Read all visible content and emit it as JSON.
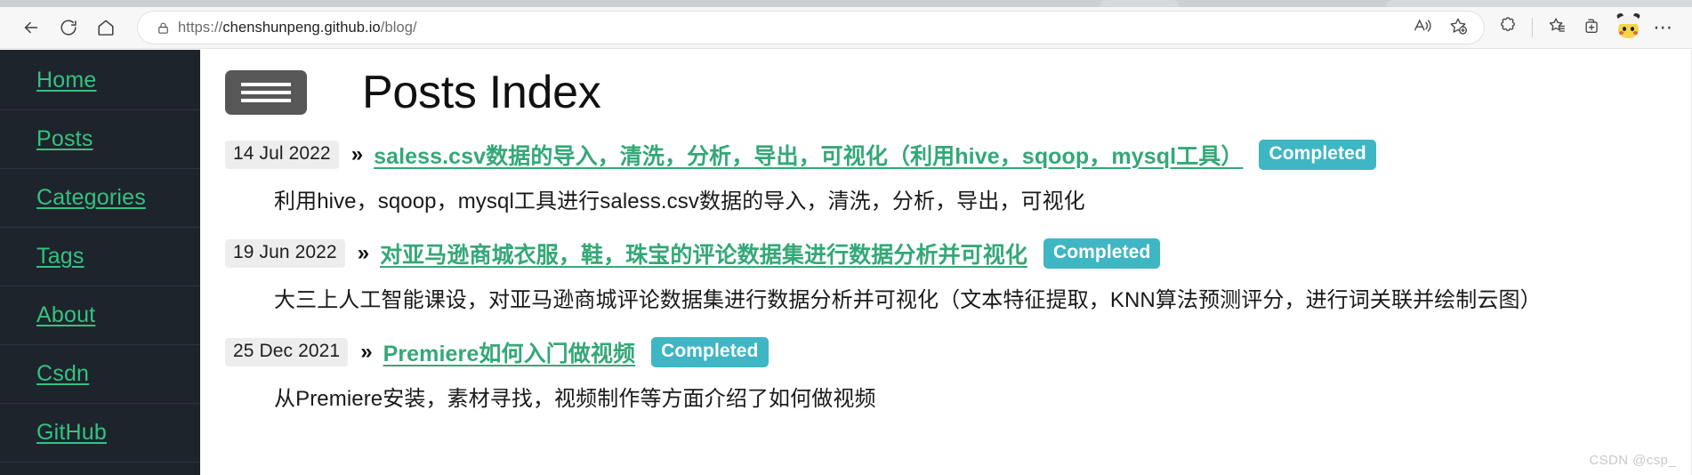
{
  "browser": {
    "back_icon": "back-arrow-icon",
    "reload_icon": "reload-icon",
    "home_icon": "home-icon",
    "lock_icon": "lock-icon",
    "url_full": "https://chenshunpeng.github.io/blog/",
    "url_scheme": "https://",
    "url_host": "chenshunpeng.github.io",
    "url_path": "/blog/",
    "read_aloud_icon": "read-aloud-icon",
    "add_favorite_icon": "add-favorite-star-icon",
    "extensions_icon": "extensions-puzzle-icon",
    "favorites_icon": "favorites-star-list-icon",
    "collections_icon": "collections-icon",
    "profile_icon": "pikachu-avatar-icon",
    "settings_more_label": "⋯"
  },
  "sidebar": {
    "items": [
      {
        "label": "Home"
      },
      {
        "label": "Posts"
      },
      {
        "label": "Categories"
      },
      {
        "label": "Tags"
      },
      {
        "label": "About"
      },
      {
        "label": "Csdn"
      },
      {
        "label": "GitHub"
      }
    ]
  },
  "main": {
    "menu_toggle_icon": "hamburger-menu-icon",
    "title": "Posts Index",
    "chevron": "»",
    "posts": [
      {
        "date": "14 Jul 2022",
        "title": "saless.csv数据的导入，清洗，分析，导出，可视化（利用hive，sqoop，mysql工具）",
        "badge": "Completed",
        "description": "利用hive，sqoop，mysql工具进行saless.csv数据的导入，清洗，分析，导出，可视化"
      },
      {
        "date": "19 Jun 2022",
        "title": "对亚马逊商城衣服，鞋，珠宝的评论数据集进行数据分析并可视化",
        "badge": "Completed",
        "description": "大三上人工智能课设，对亚马逊商城评论数据集进行数据分析并可视化（文本特征提取，KNN算法预测评分，进行词关联并绘制云图）"
      },
      {
        "date": "25 Dec 2021",
        "title": "Premiere如何入门做视频",
        "badge": "Completed",
        "description": "从Premiere安装，素材寻找，视频制作等方面介绍了如何做视频"
      }
    ]
  },
  "watermark": "CSDN @csp_",
  "colors": {
    "sidebar_bg": "#1e242c",
    "sidebar_link": "#34c281",
    "post_link": "#34a877",
    "badge_bg": "#3fb6c3",
    "date_bg": "#ededed",
    "hamburger_bg": "#575757"
  }
}
